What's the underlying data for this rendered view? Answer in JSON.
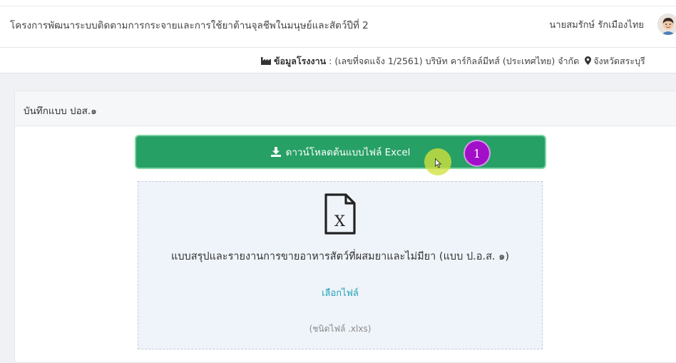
{
  "header": {
    "project_title": "โครงการพัฒนาระบบติดตามการกระจายและการใช้ยาต้านจุลชีพในมนุษย์และสัตว์ปีที่ 2",
    "user_name": "นายสมรักษ์ รักเมืองไทย"
  },
  "factory": {
    "label": "ข้อมูลโรงงาน",
    "separator": " : ",
    "detail": "(เลขที่จดแจ้ง 1/2561) บริษัท คาร์กิลล์มีทส์ (ประเทศไทย) จำกัด",
    "province": "จังหวัดสระบุรี"
  },
  "card": {
    "title": "บันทึกแบบ ปอส.๑",
    "download_label": "ดาวน์โหลดต้นแบบไฟล์ Excel",
    "step_badge": "1",
    "dropzone_title": "แบบสรุปและรายงานการขายอาหารสัตว์ที่ผสมยาและไม่มียา (แบบ ป.อ.ส. ๑)",
    "choose_file": "เลือกไฟล์",
    "file_type": "(ชนิดไฟล์ .xlxs)"
  },
  "icons": {
    "factory": "factory-icon",
    "location": "map-marker-icon",
    "download": "download-icon",
    "excel": "excel-file-icon",
    "avatar": "user-avatar"
  },
  "colors": {
    "primary_green": "#27a065",
    "badge_purple": "#a20fc8",
    "link": "#1f9fb6",
    "dropzone_bg": "#eff4fa"
  }
}
